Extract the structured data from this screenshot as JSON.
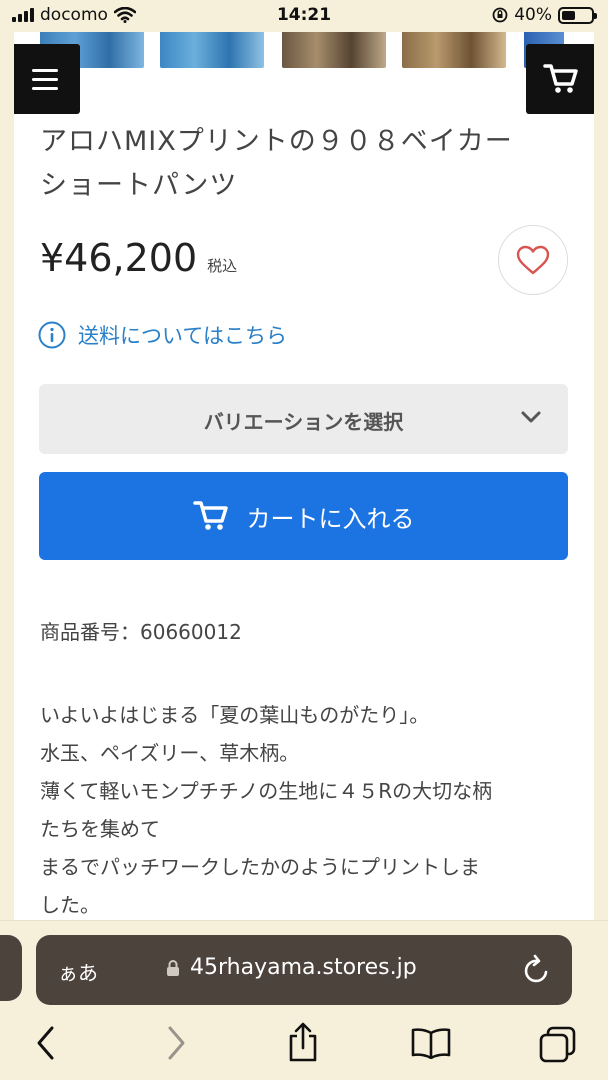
{
  "status": {
    "carrier": "docomo",
    "time": "14:21",
    "battery": "40%"
  },
  "product": {
    "title_line1": "アロハMIXプリントの９０８ベイカー",
    "title_line2": "ショートパンツ",
    "price": "¥46,200",
    "tax_label": "税込",
    "shipping_link": "送料についてはこちら",
    "variation_label": "バリエーションを選択",
    "add_to_cart": "カートに入れる",
    "product_number": "商品番号：60660012",
    "description": [
      "いよいよはじまる「夏の葉山ものがたり」。",
      "水玉、ペイズリー、草木柄。",
      "薄くて軽いモンプチチノの生地に４５Rの大切な柄",
      "たちを集めて",
      "まるでパッチワークしたかのようにプリントしま",
      "した。"
    ]
  },
  "browser": {
    "aa_label": "ぁあ",
    "url": "45rhayama.stores.jp"
  },
  "colors": {
    "accent": "#1c74e3",
    "link": "#2a80c9",
    "heart": "#d9534f",
    "chrome_bg": "#f6efd9",
    "url_bar": "#4b433c"
  }
}
